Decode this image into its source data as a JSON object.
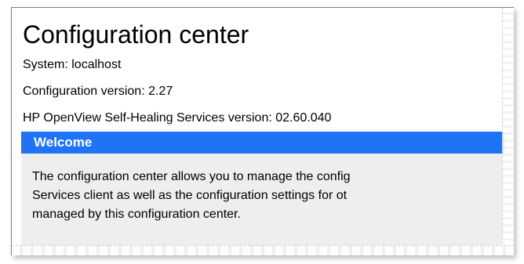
{
  "page": {
    "title": "Configuration center",
    "system_line": "System: localhost",
    "config_version_line": "Configuration version: 2.27",
    "service_version_line": "HP OpenView Self-Healing Services version: 02.60.040"
  },
  "welcome": {
    "header": "Welcome",
    "body_lines": [
      "The configuration center allows you to manage the config",
      "Services client as well as the configuration settings for ot",
      "managed by this configuration center."
    ]
  },
  "colors": {
    "section_header_bg": "#1f74f6",
    "section_body_bg": "#eeeeee"
  }
}
